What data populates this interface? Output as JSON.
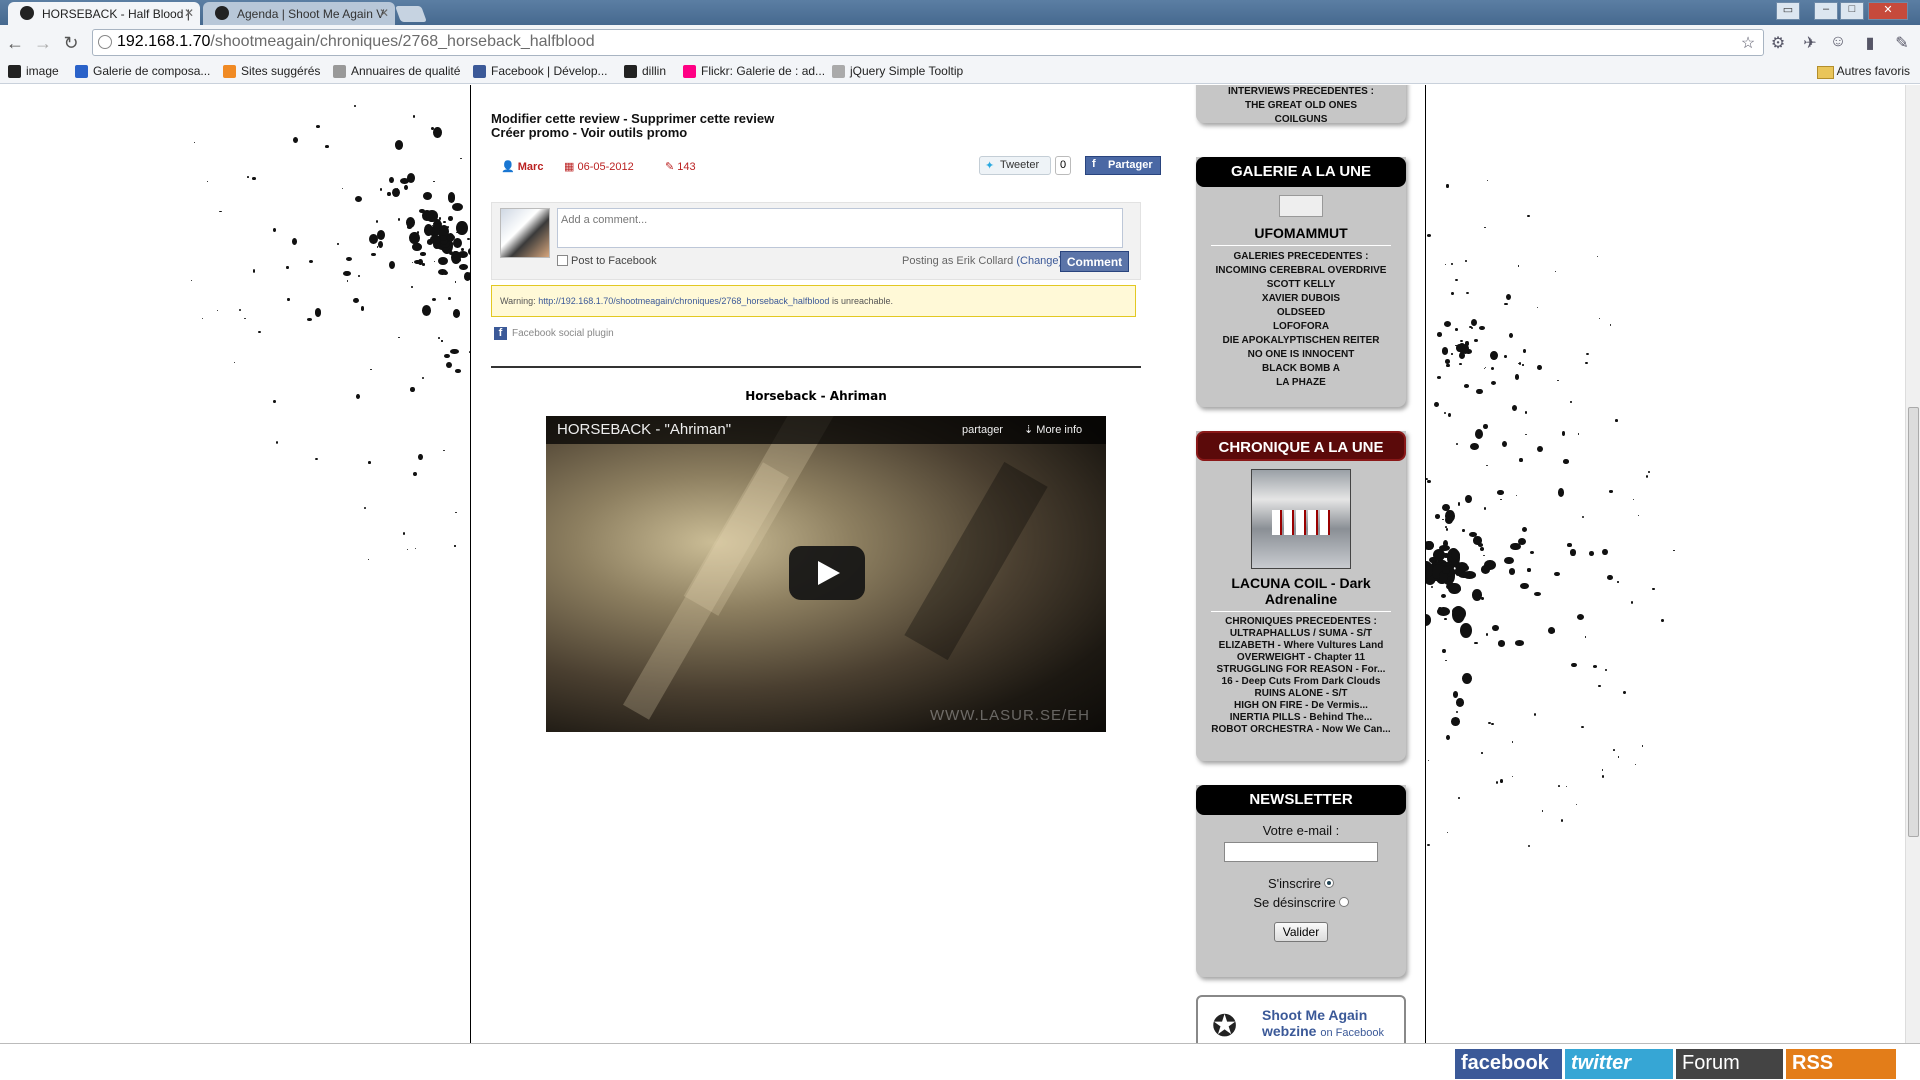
{
  "browser": {
    "tabs": [
      {
        "title": "HORSEBACK - Half Blood |",
        "active": true
      },
      {
        "title": "Agenda | Shoot Me Again V",
        "active": false
      }
    ],
    "url_host": "192.168.1.70",
    "url_path": "/shootmeagain/chroniques/2768_horseback_halfblood",
    "bookmarks": [
      {
        "label": "image",
        "color": "#222222"
      },
      {
        "label": "Galerie de composa...",
        "color": "#2a62c9"
      },
      {
        "label": "Sites suggérés",
        "color": "#f08a24"
      },
      {
        "label": "Annuaires de qualité",
        "color": "#999999"
      },
      {
        "label": "Facebook | Dévelop...",
        "color": "#3b5998"
      },
      {
        "label": "dillin",
        "color": "#222222"
      },
      {
        "label": "Flickr: Galerie de : ad...",
        "color": "#ff0084"
      },
      {
        "label": "jQuery Simple Tooltip",
        "color": "#aaaaaa"
      }
    ],
    "other_bookmarks": "Autres favoris"
  },
  "review": {
    "admin_line1": "Modifier cette review - Supprimer cette review",
    "admin_line2": "Créer promo - Voir outils promo",
    "author": "Marc",
    "date": "06-05-2012",
    "views": "143",
    "tweet_label": "Tweeter",
    "tweet_count": "0",
    "share_label": "Partager"
  },
  "facebook_comments": {
    "placeholder": "Add a comment...",
    "post_to_facebook": "Post to Facebook",
    "posting_as": "Posting as Erik Collard",
    "change": "(Change)",
    "comment_button": "Comment",
    "warning_prefix": "Warning:",
    "warning_url": "http://192.168.1.70/shootmeagain/chroniques/2768_horseback_halfblood",
    "warning_suffix": "is unreachable.",
    "social_plugin": "Facebook social plugin"
  },
  "video": {
    "heading": "Horseback - Ahriman",
    "title": "HORSEBACK - \"Ahriman\"",
    "share": "partager",
    "more_info": "More info",
    "watermark": "WWW.LASUR.SE/EH"
  },
  "sidebar": {
    "interviews": {
      "label": "INTERVIEWS PRECEDENTES :",
      "items": [
        "THE GREAT OLD ONES",
        "COILGUNS"
      ]
    },
    "galerie": {
      "heading": "GALERIE A LA UNE",
      "featured": "UFOMAMMUT",
      "label": "GALERIES PRECEDENTES :",
      "items": [
        "INCOMING CEREBRAL OVERDRIVE",
        "SCOTT KELLY",
        "XAVIER DUBOIS",
        "OLDSEED",
        "LOFOFORA",
        "DIE APOKALYPTISCHEN REITER",
        "NO ONE IS INNOCENT",
        "BLACK BOMB A",
        "LA PHAZE"
      ]
    },
    "chronique": {
      "heading": "CHRONIQUE A LA UNE",
      "featured": "LACUNA COIL - Dark Adrenaline",
      "label": "CHRONIQUES PRECEDENTES :",
      "items": [
        "ULTRAPHALLUS / SUMA - S/T",
        "ELIZABETH - Where Vultures Land",
        "OVERWEIGHT - Chapter 11",
        "STRUGGLING FOR REASON - For...",
        "16 - Deep Cuts From Dark Clouds",
        "RUINS ALONE - S/T",
        "HIGH ON FIRE - De Vermis...",
        "INERTIA PILLS - Behind The...",
        "ROBOT ORCHESTRA - Now We Can..."
      ]
    },
    "newsletter": {
      "heading": "NEWSLETTER",
      "email_label": "Votre e-mail :",
      "subscribe": "S'inscrire",
      "unsubscribe": "Se désinscrire",
      "submit": "Valider"
    },
    "facebook_card": {
      "name": "Shoot Me Again webzine",
      "suffix": "on Facebook"
    }
  },
  "social_bar": {
    "facebook": "facebook",
    "twitter": "twitter",
    "forum": "Forum",
    "rss": "RSS"
  }
}
